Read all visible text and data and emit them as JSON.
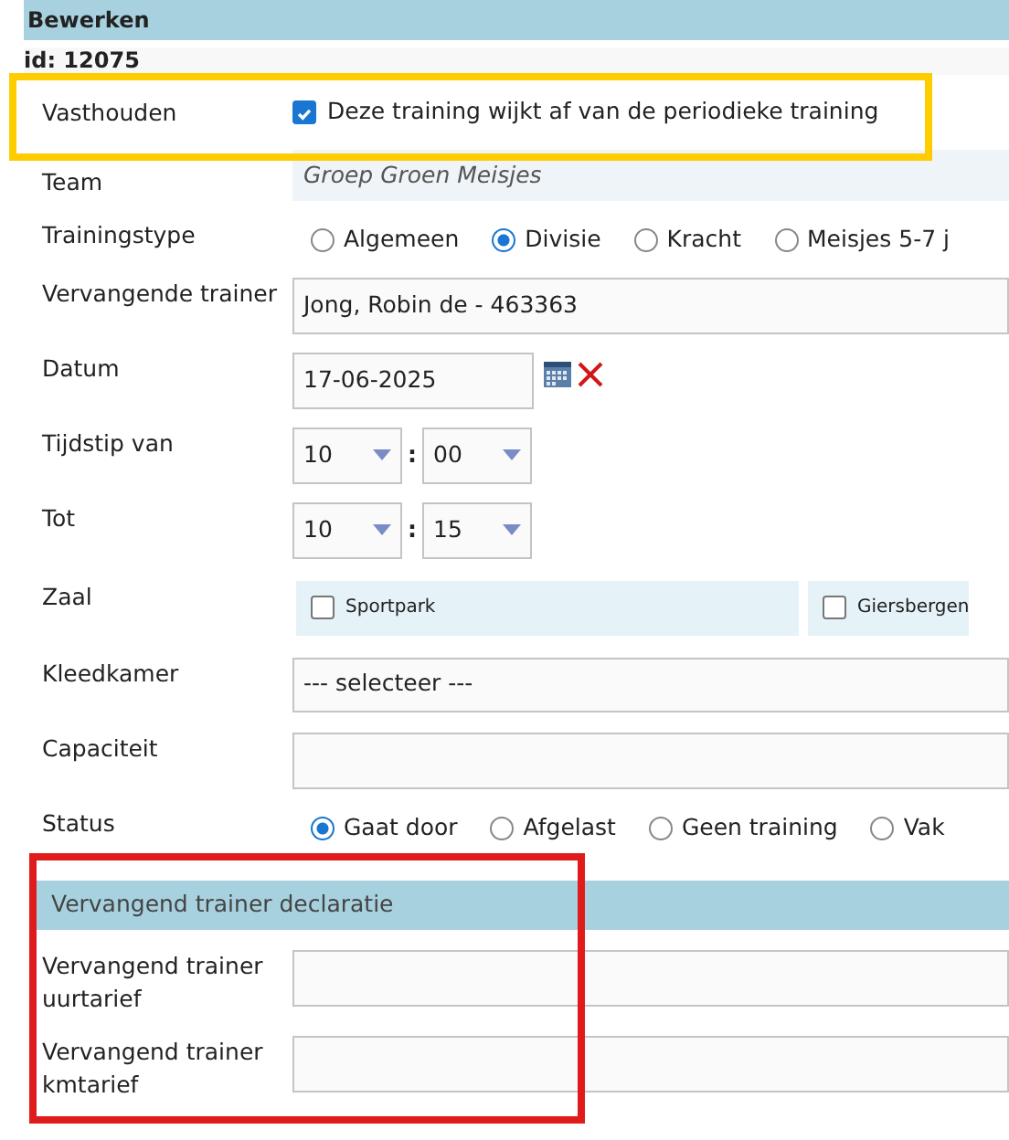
{
  "header": "Bewerken",
  "record_id": "id: 12075",
  "rows": [
    {
      "kind": "checkbox",
      "label": "Vasthouden",
      "text": "Deze training wijkt af van de periodieke training",
      "checked": true
    },
    {
      "kind": "static",
      "label": "Team",
      "value": "Groep Groen Meisjes"
    },
    {
      "kind": "radio",
      "label": "Trainingstype",
      "options": [
        {
          "text": "Algemeen",
          "selected": false
        },
        {
          "text": "Divisie",
          "selected": true
        },
        {
          "text": "Kracht",
          "selected": false
        },
        {
          "text": "Meisjes 5-7 j",
          "selected": false
        }
      ]
    },
    {
      "kind": "text",
      "label": "Vervangende trainer",
      "value": "Jong, Robin de - 463363"
    },
    {
      "kind": "date",
      "label": "Datum",
      "value": "17-06-2025"
    },
    {
      "kind": "time",
      "label": "Tijdstip van",
      "hour": "10",
      "separator": ":",
      "minute": "00"
    },
    {
      "kind": "time",
      "label": "Tot",
      "hour": "10",
      "separator": ":",
      "minute": "15"
    },
    {
      "kind": "checkgroup",
      "label": "Zaal",
      "options": [
        {
          "text": "Sportpark",
          "checked": false
        },
        {
          "text": "Giersbergen",
          "checked": false
        }
      ]
    },
    {
      "kind": "select",
      "label": "Kleedkamer",
      "value": "--- selecteer ---"
    },
    {
      "kind": "text",
      "label": "Capaciteit"
    },
    {
      "kind": "radio",
      "label": "Status",
      "options": [
        {
          "text": "Gaat door",
          "selected": true
        },
        {
          "text": "Afgelast",
          "selected": false
        },
        {
          "text": "Geen training",
          "selected": false
        },
        {
          "text": "Vak",
          "selected": false
        }
      ]
    },
    {
      "kind": "section",
      "title": "Vervangend trainer declaratie"
    },
    {
      "kind": "text",
      "label": "Vervangend trainer uurtarief"
    },
    {
      "kind": "text",
      "label": "Vervangend trainer kmtarief"
    }
  ],
  "annotations": [
    {
      "color": "#ffcc00"
    },
    {
      "color": "#e01b1b"
    }
  ]
}
